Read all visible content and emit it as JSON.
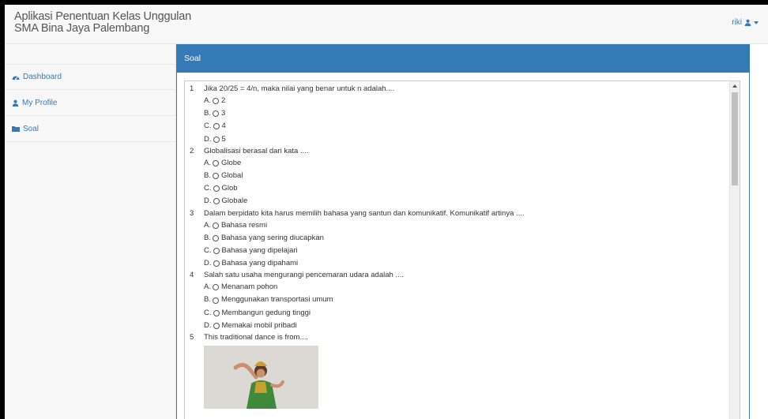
{
  "app": {
    "title_line1": "Aplikasi Penentuan Kelas Unggulan",
    "title_line2": "SMA Bina Jaya Palembang"
  },
  "user_menu": {
    "username": "riki",
    "icon": "user-icon",
    "caret": "caret-down-icon"
  },
  "sidebar": {
    "items": [
      {
        "label": "Dashboard",
        "icon": "dashboard-icon"
      },
      {
        "label": "My Profile",
        "icon": "user-icon"
      },
      {
        "label": "Soal",
        "icon": "folder-icon"
      }
    ]
  },
  "panel": {
    "heading": "Soal"
  },
  "questions": [
    {
      "number": "1",
      "text": "Jika  20/25 = 4/n, maka nilai yang benar untuk n adalah....",
      "options": [
        {
          "letter": "A.",
          "text": "2"
        },
        {
          "letter": "B.",
          "text": "3"
        },
        {
          "letter": "C.",
          "text": "4"
        },
        {
          "letter": "D.",
          "text": "5"
        }
      ]
    },
    {
      "number": "2",
      "text": "Globalisasi berasal dari kata ....",
      "options": [
        {
          "letter": "A.",
          "text": "Globe"
        },
        {
          "letter": "B.",
          "text": "Global"
        },
        {
          "letter": "C.",
          "text": "Glob"
        },
        {
          "letter": "D.",
          "text": "Globale"
        }
      ]
    },
    {
      "number": "3",
      "text": "Dalam berpidato kita harus memilih bahasa yang santun dan komunikatif. Komunikatif artinya ....",
      "options": [
        {
          "letter": "A.",
          "text": "Bahasa resmi"
        },
        {
          "letter": "B.",
          "text": "Bahasa yang sering diucapkan"
        },
        {
          "letter": "C.",
          "text": "Bahasa yang dipelajari"
        },
        {
          "letter": "D.",
          "text": "Bahasa yang dipahami"
        }
      ]
    },
    {
      "number": "4",
      "text": "Salah satu usaha mengurangi pencemaran udara adalah ....",
      "options": [
        {
          "letter": "A.",
          "text": "Menanam pohon"
        },
        {
          "letter": "B.",
          "text": "Menggunakan transportasi umum"
        },
        {
          "letter": "C.",
          "text": "Membangun gedung tinggi"
        },
        {
          "letter": "D.",
          "text": "Memakai mobil pribadi"
        }
      ]
    },
    {
      "number": "5",
      "text": "This traditional dance is from....",
      "options": []
    }
  ],
  "colors": {
    "primary": "#337ab7",
    "navbar_bg": "#f8f8f8",
    "border": "#e7e7e7"
  }
}
